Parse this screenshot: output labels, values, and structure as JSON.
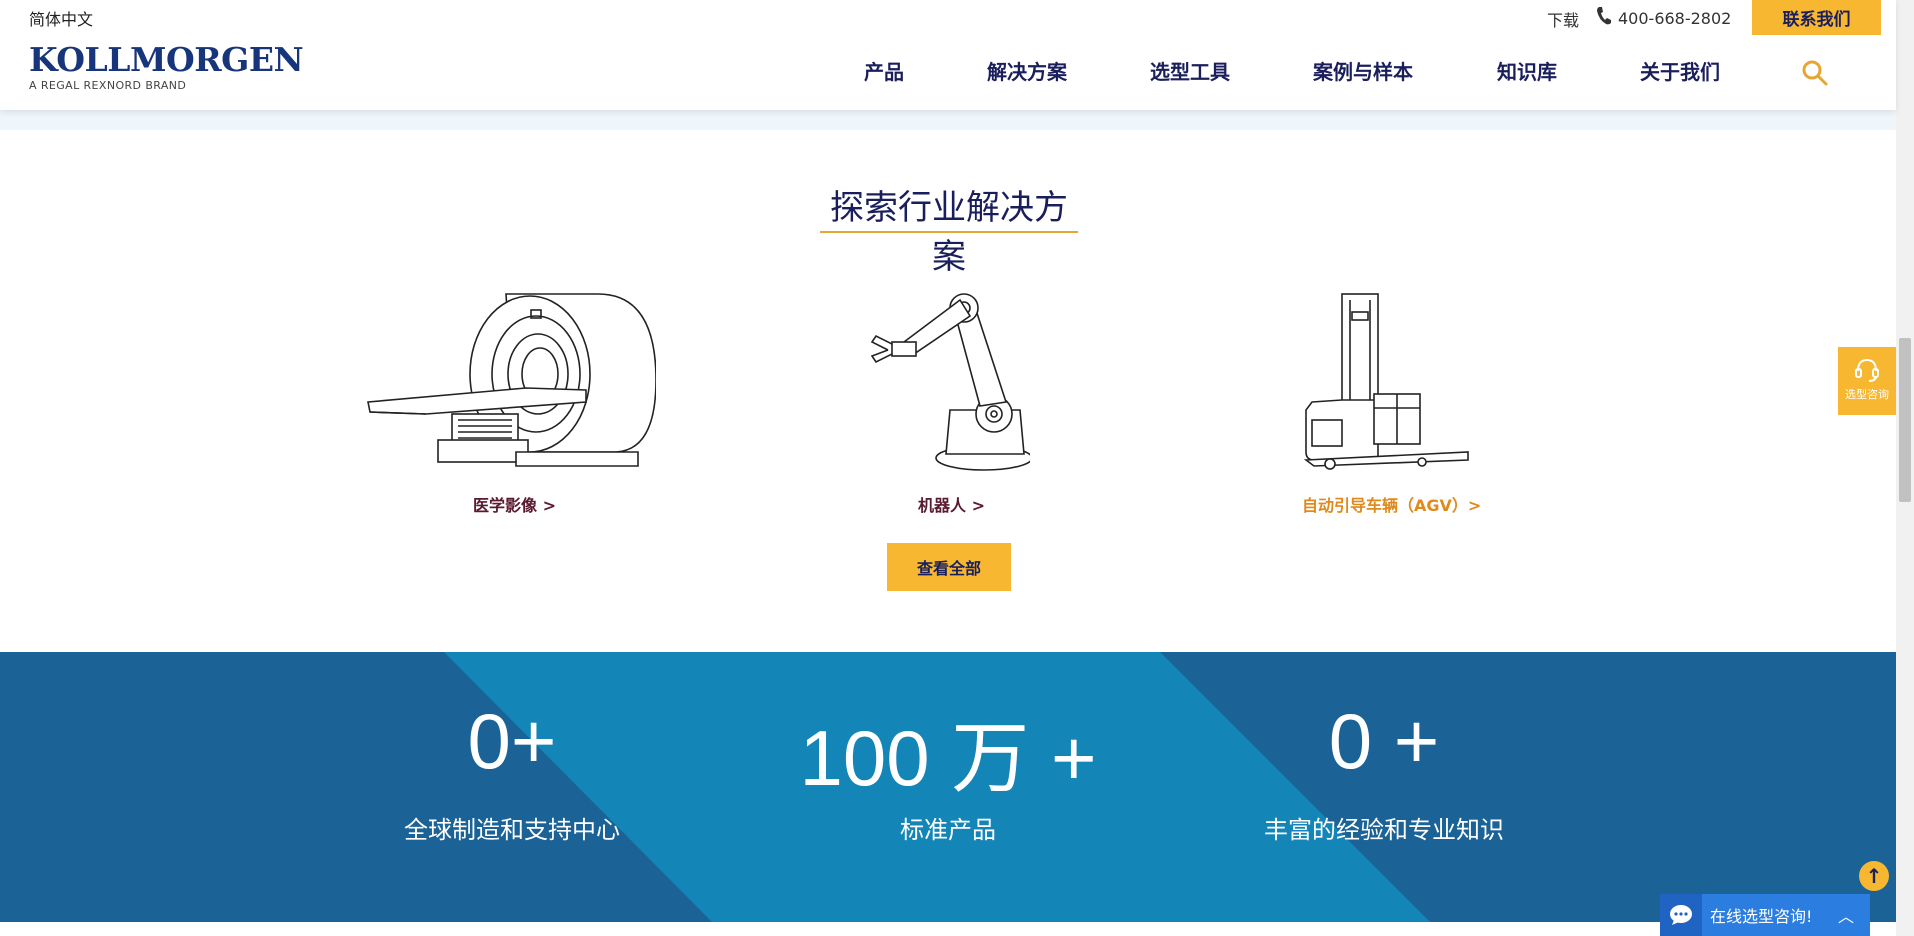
{
  "header": {
    "language": "简体中文",
    "logo_word": "KOLLMORGEN",
    "logo_tagline": "A REGAL REXNORD BRAND",
    "download": "下载",
    "phone": "400-668-2802",
    "contact_button": "联系我们",
    "nav": [
      "产品",
      "解决方案",
      "选型工具",
      "案例与样本",
      "知识库",
      "关于我们"
    ]
  },
  "section": {
    "title": "探索行业解决方案",
    "cards": [
      {
        "label": "医学影像 >",
        "color": "#5a1a2e"
      },
      {
        "label": "机器人 >",
        "color": "#5a1a2e"
      },
      {
        "label": "自动引导车辆（AGV）>",
        "color": "#e08a1c"
      }
    ],
    "view_all": "查看全部"
  },
  "stats": [
    {
      "number": "0+",
      "label": "全球制造和支持中心"
    },
    {
      "number": "100 万 +",
      "label": "标准产品"
    },
    {
      "number": "0 +",
      "label": "丰富的经验和专业知识"
    }
  ],
  "floating": {
    "consult_label": "选型咨询",
    "chat_label": "在线选型咨询!"
  },
  "colors": {
    "accent": "#f7b731",
    "navy": "#1a1f5c",
    "band_dark": "#1b6296",
    "band_light": "#1385b7"
  }
}
